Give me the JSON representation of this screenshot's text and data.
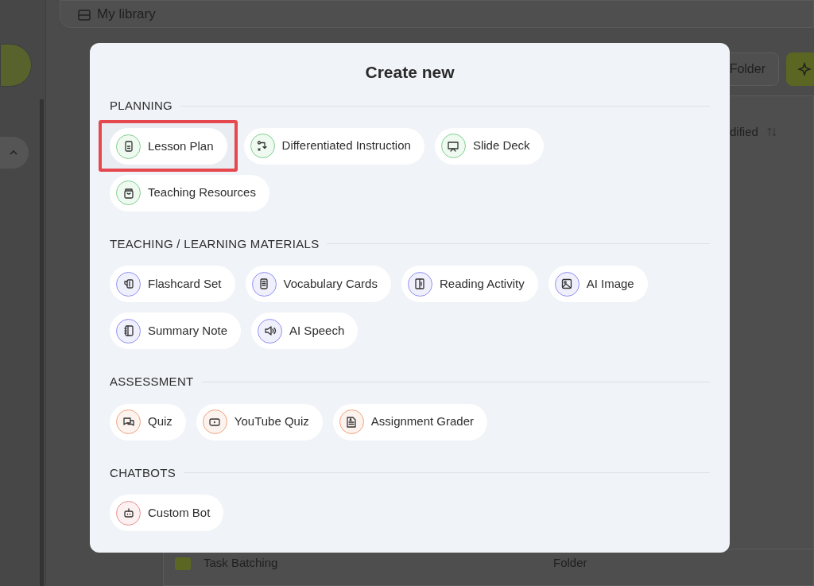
{
  "background": {
    "page_title": "My library",
    "folder_button": "Folder",
    "column_header": "dified",
    "rows": [
      {
        "name": "Task Batching",
        "type": "Folder"
      }
    ]
  },
  "dialog": {
    "title": "Create new",
    "sections": [
      {
        "heading": "PLANNING",
        "color": "#7fcf8f",
        "items": [
          {
            "label": "Lesson Plan",
            "highlighted": true
          },
          {
            "label": "Differentiated Instruction",
            "highlighted": false
          },
          {
            "label": "Slide Deck",
            "highlighted": false
          },
          {
            "label": "Teaching Resources",
            "highlighted": false
          }
        ]
      },
      {
        "heading": "TEACHING / LEARNING MATERIALS",
        "color": "#8f8ff0",
        "items": [
          {
            "label": "Flashcard Set",
            "highlighted": false
          },
          {
            "label": "Vocabulary Cards",
            "highlighted": false
          },
          {
            "label": "Reading Activity",
            "highlighted": false
          },
          {
            "label": "AI Image",
            "highlighted": false
          },
          {
            "label": "Summary Note",
            "highlighted": false
          },
          {
            "label": "AI Speech",
            "highlighted": false
          }
        ]
      },
      {
        "heading": "ASSESSMENT",
        "color": "#f0a27c",
        "items": [
          {
            "label": "Quiz",
            "highlighted": false
          },
          {
            "label": "YouTube Quiz",
            "highlighted": false
          },
          {
            "label": "Assignment Grader",
            "highlighted": false
          }
        ]
      },
      {
        "heading": "CHATBOTS",
        "color": "#e89090",
        "items": [
          {
            "label": "Custom Bot",
            "highlighted": false
          }
        ]
      }
    ]
  }
}
